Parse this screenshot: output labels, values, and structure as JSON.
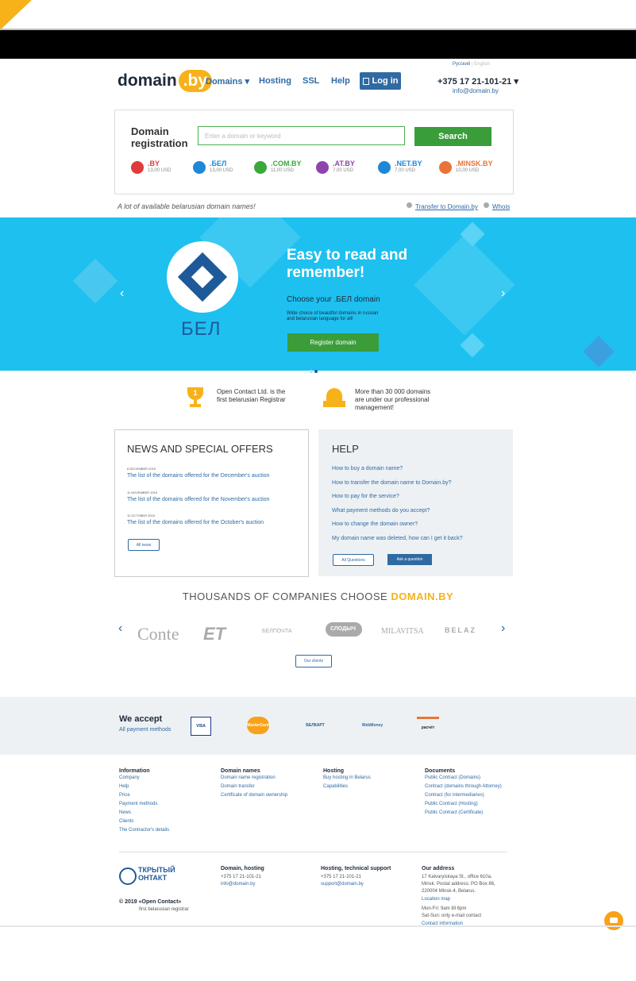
{
  "header": {
    "logo_text": "domain",
    "logo_tld": ".by",
    "nav": [
      "Domains ▾",
      "Hosting",
      "SSL",
      "Help"
    ],
    "login": "Log in",
    "lang_ru": "Русский",
    "lang_sep": "|",
    "lang_en": "English",
    "phone": "+375 17 21-101-21 ▾",
    "email": "info@domain.by"
  },
  "registration": {
    "title": "Domain registration",
    "placeholder": "Enter a domain or keyword",
    "search": "Search",
    "zones": [
      {
        "name": ".BY",
        "price": "13,00 USD",
        "color": "#e03a3a"
      },
      {
        "name": ".БЕЛ",
        "price": "13,00 USD",
        "color": "#1e88d8"
      },
      {
        "name": ".COM.BY",
        "price": "11,00 USD",
        "color": "#3aa83a"
      },
      {
        "name": ".AT.BY",
        "price": "7,00 USD",
        "color": "#8e44ad"
      },
      {
        "name": ".NET.BY",
        "price": "7,00 USD",
        "color": "#1e88d8"
      },
      {
        "name": ".MINSK.BY",
        "price": "10,00 USD",
        "color": "#e8743a"
      }
    ],
    "tagline": "A lot of available belarusian domain names!",
    "transfer": "Transfer to Domain.by",
    "whois": "Whois"
  },
  "banner": {
    "bel": "БЕЛ",
    "title_1": "Easy to read and",
    "title_2": "remember!",
    "subtitle": "Choose your .БЕЛ domain",
    "small_1": "Wide choice of beautiful domains in russian",
    "small_2": "and belarusian language for all!",
    "button": "Register domain",
    "prev": "‹",
    "next": "›",
    "bg_color": "#1ec0f0"
  },
  "features": [
    {
      "line1": "Open Contact Ltd. is the",
      "line2": "first belarusian Registrar",
      "line3": "",
      "badge": "1"
    },
    {
      "line1": "More than 30 000 domains",
      "line2": "are under our professional",
      "line3": "management!"
    }
  ],
  "news": {
    "title": "NEWS AND SPECIAL OFFERS",
    "items": [
      {
        "date": "6 DECEMBER 2019",
        "title": "The list of the domains offered for the December's auction"
      },
      {
        "date": "11 NOVEMBER 2019",
        "title": "The list of the domains offered for the November's auction"
      },
      {
        "date": "11 OCTOBER 2019",
        "title": "The list of the domains offered for the October's auction"
      }
    ],
    "all": "All news"
  },
  "help": {
    "title": "HELP",
    "questions": [
      "How to buy a domain name?",
      "How to transfer the domain name to Domain.by?",
      "How to pay for the service?",
      "What payment methods do you accept?",
      "How to change the domain owner?",
      "My domain name was deleted, how can I get it back?"
    ],
    "all": "All Questions",
    "ask": "Ask a question"
  },
  "companies": {
    "title_prefix": "THOUSANDS OF COMPANIES CHOOSE",
    "title_brand": "DOMAIN.BY",
    "logos": [
      "Conte",
      "ET",
      "БЕЛПОЧТА",
      "СЛОДЫЧ",
      "MILAVITSA",
      "BELAZ"
    ],
    "prev": "‹",
    "next": "›",
    "button": "Our clients"
  },
  "payment": {
    "title": "We accept",
    "link": "All payment methods",
    "logos": [
      "VISA",
      "MasterCard",
      "БЕЛКАРТ",
      "WebMoney",
      "расчёт"
    ]
  },
  "footer": {
    "cols": [
      {
        "head": "Information",
        "items": [
          "Company",
          "Help",
          "Price",
          "Payment methods",
          "News",
          "Clients",
          "The Contractor's details"
        ]
      },
      {
        "head": "Domain names",
        "items": [
          "Domain name registration",
          "Domain transfer",
          "Certificate of domain ownership"
        ]
      },
      {
        "head": "Hosting",
        "items": [
          "Buy hosting in Belarus",
          "Capabilities"
        ]
      },
      {
        "head": "Documents",
        "items": [
          "Public Contract (Domains)",
          "Contract (domains through Attorney)",
          "Contract (for intermediaries)",
          "Public Contract (Hosting)",
          "Public Contract (Certificate)"
        ]
      }
    ],
    "logo_1": "ТКРЫТЫЙ",
    "logo_2": "ОНТАКТ",
    "copyright": "© 2019 «Open Contact»",
    "copyright_sub": "first belarusian registrar",
    "dh_head": "Domain, hosting",
    "dh_phone": "+375 17 21-101-21",
    "dh_email": "info@domain.by",
    "ts_head": "Hosting, technical support",
    "ts_phone": "+375 17 21-101-21",
    "ts_email": "support@domain.by",
    "addr_head": "Our address",
    "addr_1": "17 Kalvaryiskaya St., office 610a,",
    "addr_2": "Minsk. Postal address: PO Box 86,",
    "addr_3": "220004 Minsk-4, Belarus.",
    "location": "Location map",
    "hours_1": "Mon-Fri: 9am till 6pm",
    "hours_2": "Sat-Sun: only e-mail contact",
    "contact": "Contact information"
  }
}
